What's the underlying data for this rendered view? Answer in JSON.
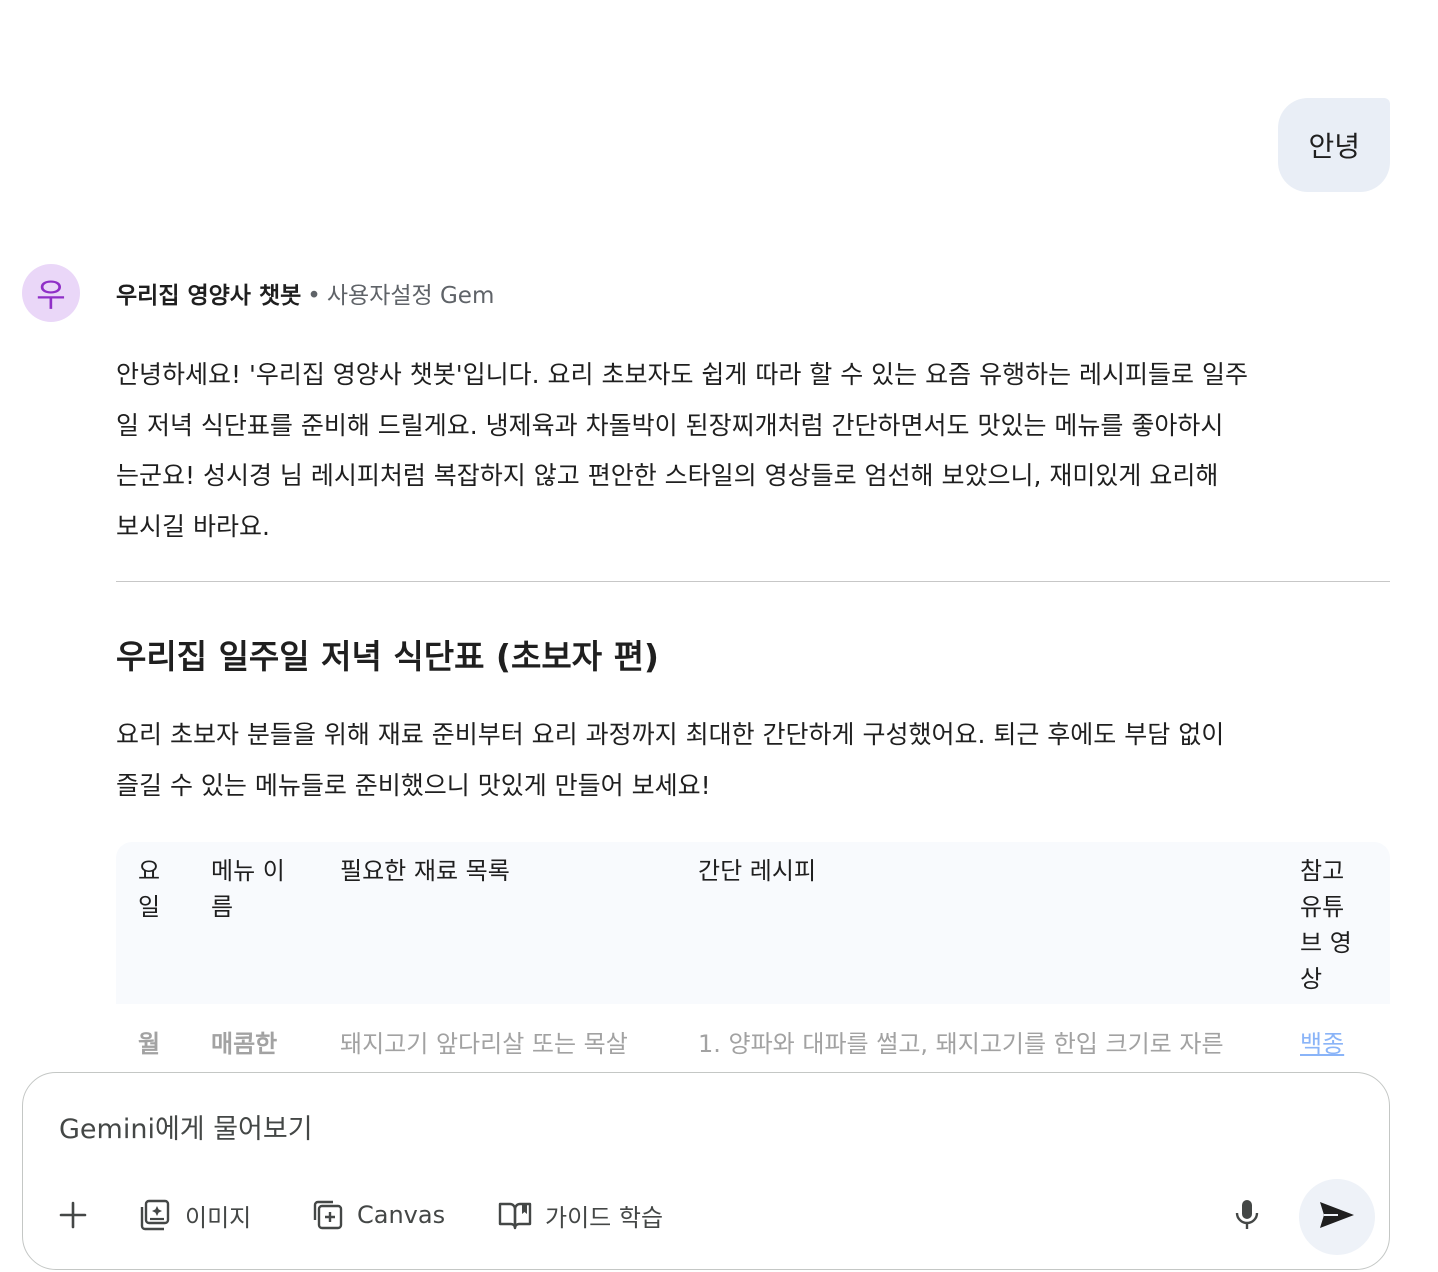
{
  "user_message": "안녕",
  "gem": {
    "avatar_letter": "우",
    "name": "우리집 영양사 챗봇",
    "separator": "•",
    "type": "사용자설정 Gem"
  },
  "response": {
    "intro_lines": [
      "안녕하세요! '우리집 영양사 챗봇'입니다. 요리 초보자도 쉽게 따라 할 수 있는 요즘 유행하는 레시피들로 일주",
      "일 저녁 식단표를 준비해 드릴게요. 냉제육과 차돌박이 된장찌개처럼 간단하면서도 맛있는 메뉴를 좋아하시",
      "는군요! 성시경 님 레시피처럼 복잡하지 않고 편안한 스타일의 영상들로 엄선해 보았으니, 재미있게 요리해",
      "보시길 바라요."
    ],
    "heading": "우리집 일주일 저녁 식단표 (초보자 편)",
    "desc_lines": [
      "요리 초보자 분들을 위해 재료 준비부터 요리 과정까지 최대한 간단하게 구성했어요. 퇴근 후에도 부담 없이",
      "즐길 수 있는 메뉴들로 준비했으니 맛있게 만들어 보세요!"
    ]
  },
  "table": {
    "headers": {
      "day": [
        "요",
        "일"
      ],
      "menu": [
        "메뉴 이",
        "름"
      ],
      "ingredients": [
        "필요한 재료 목록"
      ],
      "recipe": [
        "간단 레시피"
      ],
      "video": [
        "참고",
        "유튜",
        "브 영",
        "상"
      ]
    },
    "row1": {
      "day": "월",
      "menu": "매콤한",
      "ingredients": "돼지고기 앞다리살 또는 목살",
      "recipe": "1. 양파와 대파를 썰고, 돼지고기를 한입 크기로 자른",
      "video": "백종"
    }
  },
  "input": {
    "placeholder": "Gemini에게 물어보기",
    "image_label": "이미지",
    "canvas_label": "Canvas",
    "guide_label": "가이드 학습"
  }
}
